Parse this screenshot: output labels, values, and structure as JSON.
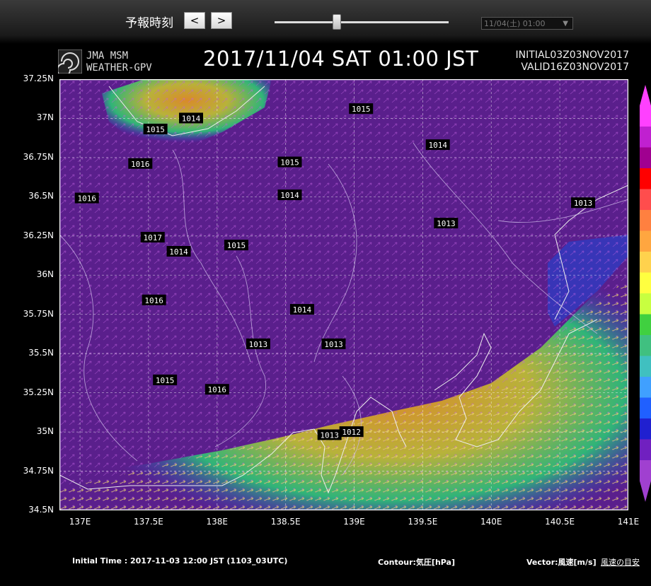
{
  "header": {
    "forecast_label": "予報時刻",
    "prev_label": "<",
    "next_label": ">",
    "slider_fraction": 0.35,
    "time_select_value": "11/04(土) 01:00"
  },
  "title": {
    "brand_line1": "JMA MSM",
    "brand_line2": "WEATHER-GPV",
    "datetime": "2017/11/04 SAT 01:00 JST",
    "initial": "INITIAL03Z03NOV2017",
    "valid": "VALID16Z03NOV2017"
  },
  "map_data": {
    "lat_labels": [
      "37.25N",
      "37N",
      "36.75N",
      "36.5N",
      "36.25N",
      "36N",
      "35.75N",
      "35.5N",
      "35.25N",
      "35N",
      "34.75N",
      "34.5N"
    ],
    "lon_labels": [
      "137E",
      "137.5E",
      "138E",
      "138.5E",
      "139E",
      "139.5E",
      "140E",
      "140.5E",
      "141E"
    ],
    "lat_range": [
      34.5,
      37.25
    ],
    "lon_range": [
      136.85,
      141.0
    ],
    "contour_labels": [
      {
        "text": "1015",
        "lat": 37.06,
        "lon": 139.05
      },
      {
        "text": "1014",
        "lat": 37.0,
        "lon": 137.81
      },
      {
        "text": "1015",
        "lat": 36.93,
        "lon": 137.55
      },
      {
        "text": "1014",
        "lat": 36.83,
        "lon": 139.61
      },
      {
        "text": "1016",
        "lat": 36.71,
        "lon": 137.44
      },
      {
        "text": "1015",
        "lat": 36.72,
        "lon": 138.53
      },
      {
        "text": "1016",
        "lat": 36.49,
        "lon": 137.05
      },
      {
        "text": "1014",
        "lat": 36.51,
        "lon": 138.53
      },
      {
        "text": "1013",
        "lat": 36.33,
        "lon": 139.67
      },
      {
        "text": "1013",
        "lat": 36.46,
        "lon": 140.67
      },
      {
        "text": "1017",
        "lat": 36.24,
        "lon": 137.53
      },
      {
        "text": "1015",
        "lat": 36.19,
        "lon": 138.14
      },
      {
        "text": "1014",
        "lat": 36.15,
        "lon": 137.72
      },
      {
        "text": "1016",
        "lat": 35.84,
        "lon": 137.54
      },
      {
        "text": "1014",
        "lat": 35.78,
        "lon": 138.62
      },
      {
        "text": "1013",
        "lat": 35.56,
        "lon": 138.3
      },
      {
        "text": "1013",
        "lat": 35.56,
        "lon": 138.85
      },
      {
        "text": "1015",
        "lat": 35.33,
        "lon": 137.62
      },
      {
        "text": "1016",
        "lat": 35.27,
        "lon": 138.0
      },
      {
        "text": "1013",
        "lat": 34.98,
        "lon": 138.82
      },
      {
        "text": "1012",
        "lat": 35.0,
        "lon": 138.98
      }
    ],
    "colors": {
      "land_sea_purple": "#5a1f8c",
      "weak_blue": "#2a3fc9",
      "mid_green": "#30b478",
      "strong_yellow": "#b8b23a",
      "orange": "#d98a2a"
    }
  },
  "colorbar": [
    "#ff40ff",
    "#c020d0",
    "#a00090",
    "#ff0000",
    "#ff4d4d",
    "#ff8040",
    "#ffa640",
    "#ffd24d",
    "#ffff40",
    "#c8ff40",
    "#40d040",
    "#40c080",
    "#40c0c0",
    "#40a0ff",
    "#2060ff",
    "#2020d0",
    "#7020c0",
    "#a040d0"
  ],
  "footer": {
    "initial_time": "Initial Time : 2017-11-03 12:00 JST (1103_03UTC)",
    "contour": "Contour:気圧[hPa]",
    "vector": "Vector:風速[m/s]",
    "wind_link": "風速の目安"
  }
}
